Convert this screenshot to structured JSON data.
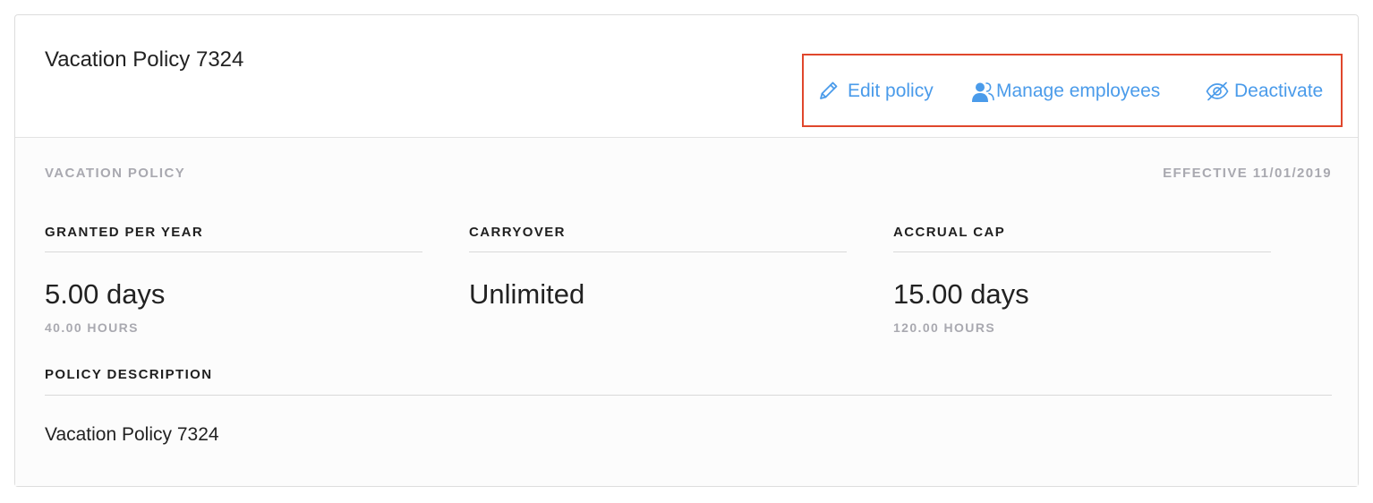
{
  "header": {
    "title": "Vacation Policy 7324",
    "actions": {
      "edit_label": "Edit policy",
      "manage_label": "Manage employees",
      "deactivate_label": "Deactivate"
    }
  },
  "summary": {
    "policy_type": "VACATION POLICY",
    "effective": "EFFECTIVE 11/01/2019"
  },
  "stats": [
    {
      "label": "GRANTED PER YEAR",
      "value": "5.00 days",
      "sub": "40.00 HOURS"
    },
    {
      "label": "CARRYOVER",
      "value": "Unlimited",
      "sub": ""
    },
    {
      "label": "ACCRUAL CAP",
      "value": "15.00 days",
      "sub": "120.00 HOURS"
    }
  ],
  "description": {
    "label": "POLICY DESCRIPTION",
    "text": "Vacation Policy 7324"
  },
  "colors": {
    "accent": "#4a9bea",
    "highlight_box": "#e0472c",
    "muted_text": "#a9a9b0"
  },
  "icons": {
    "edit": "pencil-icon",
    "manage": "users-icon",
    "deactivate": "eye-off-icon"
  }
}
